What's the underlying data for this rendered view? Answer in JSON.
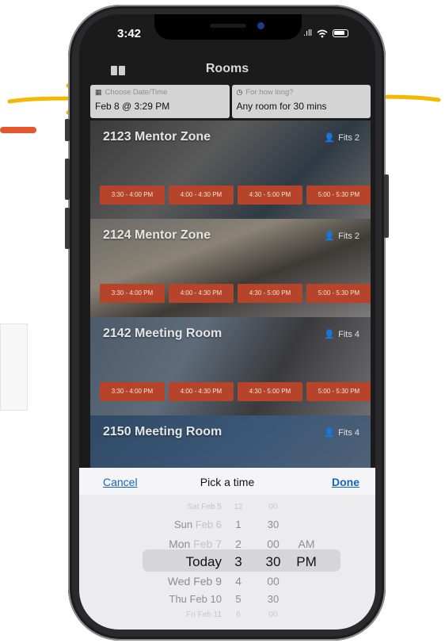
{
  "status": {
    "time": "3:42",
    "signal": ".ıll"
  },
  "nav": {
    "title": "Rooms"
  },
  "filters": {
    "date": {
      "hint": "Choose Date/Time",
      "value": "Feb 8 @ 3:29 PM"
    },
    "duration": {
      "hint": "For how long?",
      "value": "Any room for 30 mins"
    }
  },
  "rooms": [
    {
      "name": "2123 Mentor Zone",
      "fits": "Fits 2",
      "slots": [
        "3:30 - 4:00 PM",
        "4:00 - 4:30 PM",
        "4:30 - 5:00 PM",
        "5:00 - 5:30 PM"
      ]
    },
    {
      "name": "2124 Mentor Zone",
      "fits": "Fits 2",
      "slots": [
        "3:30 - 4:00 PM",
        "4:00 - 4:30 PM",
        "4:30 - 5:00 PM",
        "5:00 - 5:30 PM"
      ]
    },
    {
      "name": "2142 Meeting Room",
      "fits": "Fits 4",
      "slots": [
        "3:30 - 4:00 PM",
        "4:00 - 4:30 PM",
        "4:30 - 5:00 PM",
        "5:00 - 5:30 PM"
      ]
    },
    {
      "name": "2150 Meeting Room",
      "fits": "Fits 4",
      "slots": []
    }
  ],
  "picker": {
    "cancel_label": "Cancel",
    "title": "Pick a time",
    "done_label": "Done",
    "day_column": [
      {
        "strong": "Sat",
        "light": "Feb 5"
      },
      {
        "strong": "Sun",
        "light": "Feb 6"
      },
      {
        "strong": "Mon",
        "light": "Feb 7"
      },
      {
        "strong": "Today",
        "light": ""
      },
      {
        "strong": "Wed Feb 9",
        "light": ""
      },
      {
        "strong": "Thu Feb 10",
        "light": ""
      },
      {
        "strong": "Fri Feb 11",
        "light": ""
      }
    ],
    "hour_column": [
      "12",
      "1",
      "2",
      "3",
      "4",
      "5",
      "6"
    ],
    "minute_column": [
      "00",
      "30",
      "00",
      "30",
      "00",
      "30",
      "00"
    ],
    "ampm_column": [
      "",
      "",
      "AM",
      "PM",
      "",
      "",
      ""
    ],
    "selected": {
      "day": "Today",
      "hour": "3",
      "minute": "30",
      "ampm": "PM"
    }
  },
  "colors": {
    "slot": "#b5442a",
    "link": "#1565c0",
    "annotation_arrow": "#f5b800",
    "annotation_dash": "#e4572e"
  }
}
